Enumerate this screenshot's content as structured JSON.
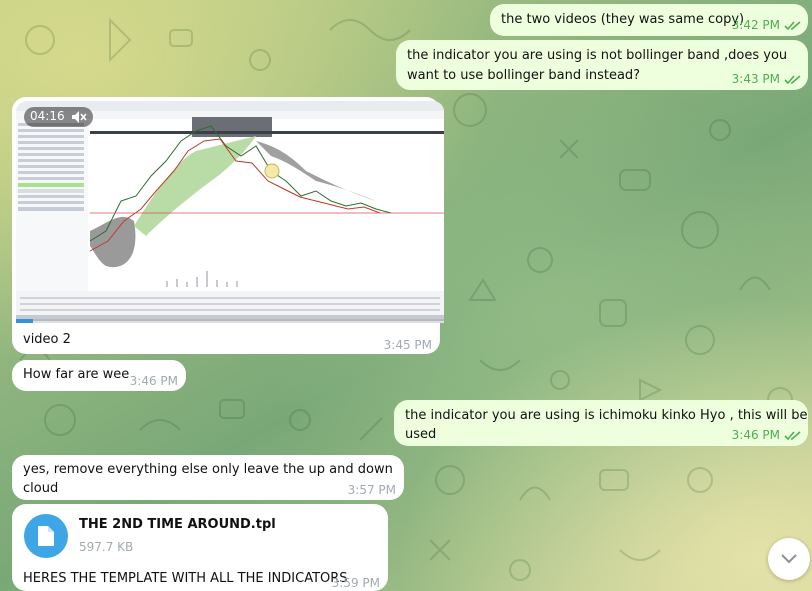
{
  "messages": [
    {
      "text": "the two videos (they was same copy)",
      "time": "3:42 PM"
    },
    {
      "text": "the indicator you are using is not bollinger band ,does you want to use bollinger band instead?",
      "time": "3:43 PM"
    },
    {
      "video_duration": "04:16",
      "caption": "video 2",
      "time": "3:45 PM",
      "progress": 0.04
    },
    {
      "text": "How far are wee",
      "time": "3:46 PM"
    },
    {
      "text": "the indicator you are using is ichimoku kinko Hyo , this will be used",
      "time": "3:46 PM"
    },
    {
      "text": "yes, remove everything else only leave the up and down cloud",
      "time": "3:57 PM"
    },
    {
      "file_name": "THE 2ND TIME AROUND.tpl",
      "file_size": "597.7 KB",
      "caption": "HERES THE TEMPLATE WITH ALL THE INDICATORS",
      "time": "3:59 PM"
    }
  ],
  "icons": {
    "read_receipt": "double-check-icon",
    "mute": "speaker-muted-icon",
    "file": "document-icon",
    "scroll": "chevron-down-icon"
  },
  "colors": {
    "outgoing_bubble": "#eeffde",
    "incoming_bubble": "#ffffff",
    "outgoing_meta": "#4fae4e",
    "file_icon": "#3ea6e4"
  }
}
